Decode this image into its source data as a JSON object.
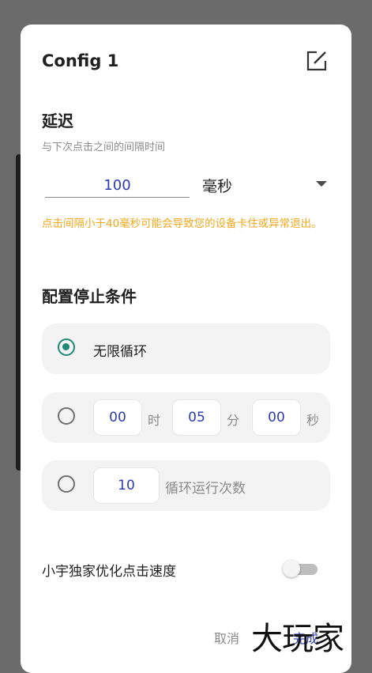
{
  "dialog": {
    "title": "Config 1",
    "delay": {
      "title": "延迟",
      "description": "与下次点击之间的间隔时间",
      "value": "100",
      "unit": "毫秒",
      "warning": "点击间隔小于40毫秒可能会导致您的设备卡住或异常退出。"
    },
    "stop": {
      "title": "配置停止条件",
      "option_infinite_label": "无限循环",
      "time": {
        "hours": "00",
        "hours_unit": "时",
        "minutes": "05",
        "minutes_unit": "分",
        "seconds": "00",
        "seconds_unit": "秒"
      },
      "loops": {
        "value": "10",
        "label": "循环运行次数"
      },
      "selected": "infinite"
    },
    "optimize_label": "小宇独家优化点击速度",
    "optimize_enabled": false,
    "cancel_label": "取消",
    "done_label": "完成"
  },
  "watermark": "大玩家",
  "icons": {
    "edit": "edit-icon",
    "dropdown": "chevron-down-icon"
  },
  "colors": {
    "accent": "#1d8a74",
    "value_blue": "#2c3cb0",
    "warning": "#f2a71b"
  }
}
